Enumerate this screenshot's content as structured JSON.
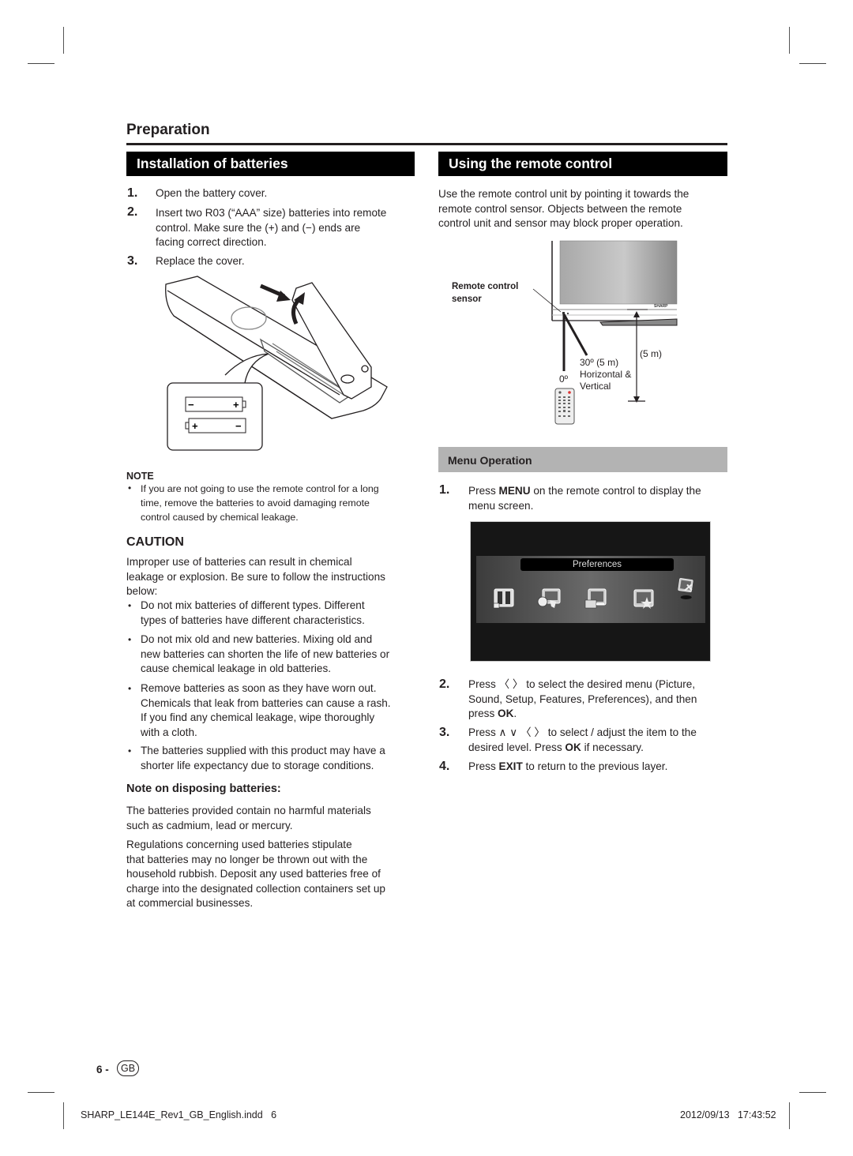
{
  "header": {
    "section_title": "Preparation"
  },
  "installation": {
    "title": "Installation of batteries",
    "steps": [
      {
        "num": "1.",
        "text": "Open the battery cover."
      },
      {
        "num": "2.",
        "line1": "Insert two R03 (“AAA” size) batteries into remote",
        "line2": "control. Make sure the (+) and (−) ends are",
        "line3": "facing correct direction."
      },
      {
        "num": "3.",
        "text": "Replace the cover."
      }
    ],
    "illustration": {
      "battery_top": {
        "left": "−",
        "right": "+"
      },
      "battery_bottom": {
        "left": "+",
        "right": "−"
      }
    }
  },
  "note": {
    "heading": "NOTE",
    "bullet": "•",
    "lines": [
      "If you are not going to use the remote control for a long",
      "time, remove the batteries to avoid damaging remote",
      "control caused by chemical leakage."
    ]
  },
  "caution": {
    "heading": "CAUTION",
    "intro": [
      "Improper use of batteries can result in chemical",
      "leakage or explosion. Be sure to follow the instructions",
      "below:"
    ],
    "bullets": [
      [
        "Do not mix batteries of different types. Different",
        "types of batteries have different characteristics."
      ],
      [
        "Do not mix old and new batteries. Mixing old and",
        "new batteries can shorten the life of new batteries or",
        "cause chemical leakage in old batteries."
      ],
      [
        "Remove batteries as soon as they have worn out.",
        "Chemicals that leak from batteries can cause a rash.",
        "If you find any chemical leakage, wipe thoroughly",
        "with a cloth."
      ],
      [
        "The batteries supplied with this product may have a",
        "shorter life expectancy due to storage conditions."
      ]
    ]
  },
  "disposal": {
    "heading": "Note on disposing batteries:",
    "para1": [
      "The batteries provided contain no harmful materials",
      "such as cadmium, lead or mercury."
    ],
    "para2": [
      "Regulations concerning used batteries stipulate",
      "that batteries may no longer be thrown out with the",
      "household rubbish. Deposit any used batteries free of",
      "charge into the designated collection containers set up",
      "at commercial businesses."
    ]
  },
  "remote": {
    "title": "Using the remote control",
    "intro": [
      "Use the remote control unit by pointing it towards the",
      "remote control sensor. Objects between the remote",
      "control unit and sensor may block proper operation."
    ],
    "diagram": {
      "sensor_label_1": "Remote control",
      "sensor_label_2": "sensor",
      "brand": "SHARP",
      "angle_zero": "0º",
      "angle_label_1": "30º (5 m)",
      "angle_label_2": "Horizontal &",
      "angle_label_3": "Vertical",
      "distance": "(5 m)"
    }
  },
  "menu_operation": {
    "title": "Menu Operation",
    "step1": {
      "num": "1.",
      "pre": "Press ",
      "bold": "MENU",
      "post": " on the remote control to display the",
      "line2": "menu screen."
    },
    "screen": {
      "selected_label": "Preferences",
      "icons": [
        "picture-menu-icon",
        "sound-menu-icon",
        "setup-menu-icon",
        "features-menu-icon",
        "preferences-menu-icon"
      ]
    },
    "step2": {
      "num": "2.",
      "pre": "Press ",
      "arrows": "〈  〉",
      "post": " to select the desired menu (Picture,",
      "line2": "Sound, Setup, Features, Preferences), and then",
      "line3_pre": "press ",
      "line3_bold": "OK",
      "line3_post": "."
    },
    "step3": {
      "num": "3.",
      "pre": "Press ",
      "arrows": "∧  ∨  〈  〉",
      "post": " to select / adjust the item to the",
      "line2_pre": "desired level. Press ",
      "line2_bold": "OK",
      "line2_post": " if necessary."
    },
    "step4": {
      "num": "4.",
      "pre": "Press ",
      "bold": "EXIT",
      "post": " to return to the previous layer."
    }
  },
  "footer": {
    "page_number": "6 -",
    "region_badge": "GB",
    "file_name": "SHARP_LE144E_Rev1_GB_English.indd   6",
    "date_time": "2012/09/13   17:43:52"
  }
}
